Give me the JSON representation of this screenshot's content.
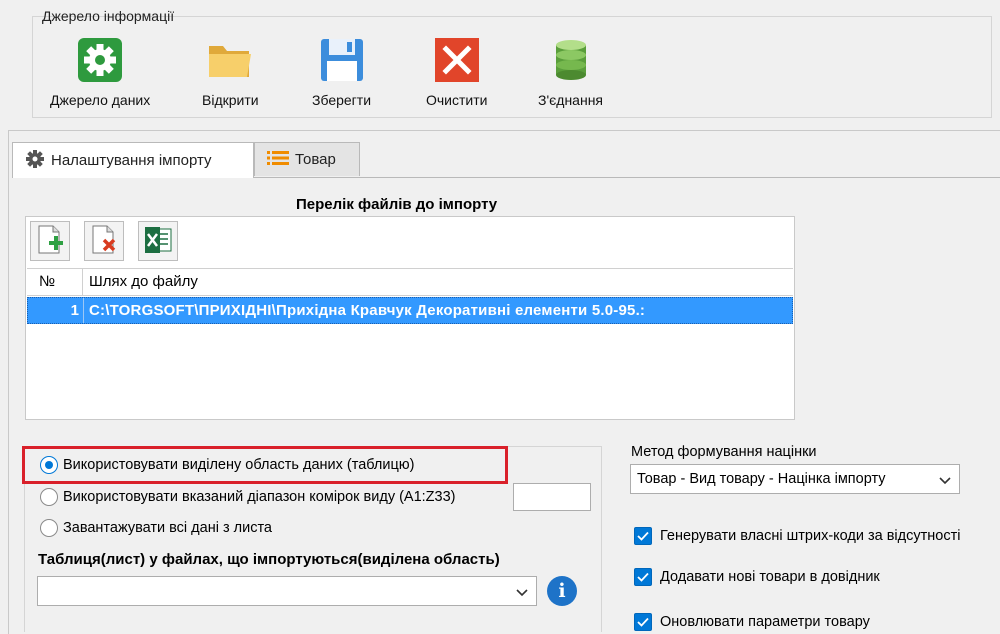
{
  "ribbon": {
    "title": "Джерело інформації",
    "buttons": [
      {
        "label": "Джерело даних",
        "icon": "gear-icon"
      },
      {
        "label": "Відкрити",
        "icon": "folder-icon"
      },
      {
        "label": "Зберегти",
        "icon": "floppy-disk-icon"
      },
      {
        "label": "Очистити",
        "icon": "clear-x-icon"
      },
      {
        "label": "З'єднання",
        "icon": "database-icon"
      }
    ]
  },
  "tabs": [
    {
      "label": "Налаштування імпорту",
      "icon": "gear-icon",
      "active": true
    },
    {
      "label": "Товар",
      "icon": "list-icon",
      "active": false
    }
  ],
  "files": {
    "title": "Перелік файлів до імпорту",
    "toolbar": [
      "add-file-icon",
      "delete-file-icon",
      "excel-icon"
    ],
    "columns": [
      "№",
      "Шлях до файлу"
    ],
    "rows": [
      {
        "num": "1",
        "path": "C:\\TORGSOFT\\ПРИХІДНІ\\Прихідна Кравчук Декоративні елементи 5.0-95.:"
      }
    ]
  },
  "range_options": {
    "selected": 0,
    "items": [
      "Використовувати виділену область даних (таблицю)",
      "Використовувати вказаний діапазон комірок виду (A1:Z33)",
      "Завантажувати всі дані з листа"
    ],
    "range_value": ""
  },
  "table_sheet": {
    "label": "Таблиця(лист) у файлах, що імпортуються(виділена область)",
    "value": "",
    "info_label": "i"
  },
  "markup": {
    "label": "Метод формування націнки",
    "value": "Товар - Вид товару - Націнка імпорту"
  },
  "checkboxes": [
    {
      "label": "Генерувати власні штрих-коди за відсутності",
      "checked": true
    },
    {
      "label": "Додавати нові товари в довідник",
      "checked": true
    },
    {
      "label": "Оновлювати параметри товару",
      "checked": true
    }
  ],
  "colors": {
    "selection": "#3399ff",
    "accent": "#0078d7",
    "highlight_border": "#d9202a"
  }
}
